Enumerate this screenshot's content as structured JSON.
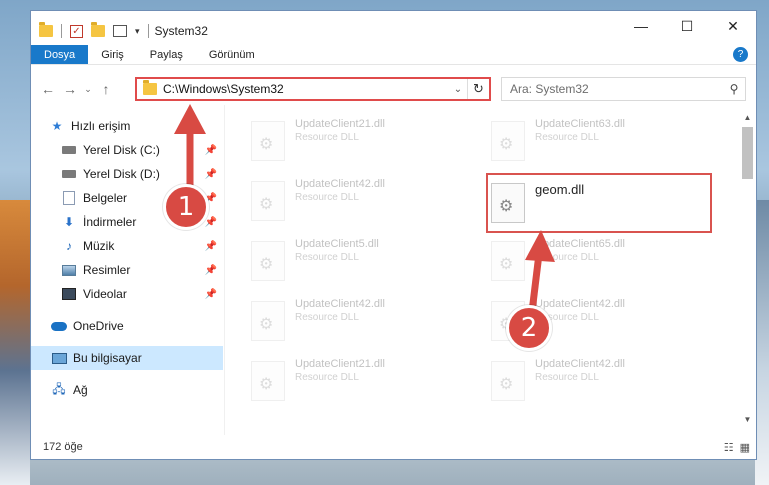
{
  "window": {
    "title": "System32",
    "controls": {
      "minimize": "—",
      "maximize": "☐",
      "close": "✕"
    }
  },
  "ribbon": {
    "tabs": [
      {
        "label": "Dosya",
        "active": true
      },
      {
        "label": "Giriş"
      },
      {
        "label": "Paylaş"
      },
      {
        "label": "Görünüm"
      }
    ],
    "help": "?"
  },
  "nav": {
    "back": "←",
    "forward": "→",
    "recent": "⌄",
    "up": "↑",
    "address": "C:\\Windows\\System32",
    "address_dropdown": "⌄",
    "refresh": "↻",
    "search_placeholder": "Ara: System32"
  },
  "sidebar": {
    "items": [
      {
        "label": "Hızlı erişim",
        "icon": "star-icon"
      },
      {
        "label": "Yerel Disk (C:)",
        "icon": "drive-icon",
        "pinned": true
      },
      {
        "label": "Yerel Disk (D:)",
        "icon": "drive-icon",
        "pinned": true
      },
      {
        "label": "Belgeler",
        "icon": "documents-icon",
        "pinned": true
      },
      {
        "label": "İndirmeler",
        "icon": "downloads-icon",
        "pinned": true
      },
      {
        "label": "Müzik",
        "icon": "music-icon",
        "pinned": true
      },
      {
        "label": "Resimler",
        "icon": "pictures-icon",
        "pinned": true
      },
      {
        "label": "Videolar",
        "icon": "videos-icon",
        "pinned": true
      },
      {
        "label": "OneDrive",
        "icon": "cloud-icon"
      },
      {
        "label": "Bu bilgisayar",
        "icon": "computer-icon",
        "selected": true
      },
      {
        "label": "Ağ",
        "icon": "network-icon"
      }
    ]
  },
  "files": [
    {
      "name": "UpdateClient21.dll",
      "type": "Resource DLL"
    },
    {
      "name": "UpdateClient63.dll",
      "type": "Resource DLL"
    },
    {
      "name": "UpdateClient42.dll",
      "type": "Resource DLL"
    },
    {
      "name": "geom.dll",
      "type": ""
    },
    {
      "name": "UpdateClient5.dll",
      "type": "Resource DLL"
    },
    {
      "name": "UpdateClient65.dll",
      "type": "Resource DLL"
    },
    {
      "name": "UpdateClient42.dll",
      "type": "Resource DLL"
    },
    {
      "name": "UpdateClient42.dll",
      "type": "Resource DLL"
    },
    {
      "name": "UpdateClient21.dll",
      "type": "Resource DLL"
    },
    {
      "name": "UpdateClient42.dll",
      "type": "Resource DLL"
    }
  ],
  "status": {
    "count": "172 öğe"
  },
  "annotations": {
    "step1": "1",
    "step2": "2"
  },
  "colors": {
    "accent": "#1979ca",
    "highlight": "#d9534f",
    "selected_bg": "#cce8ff"
  }
}
